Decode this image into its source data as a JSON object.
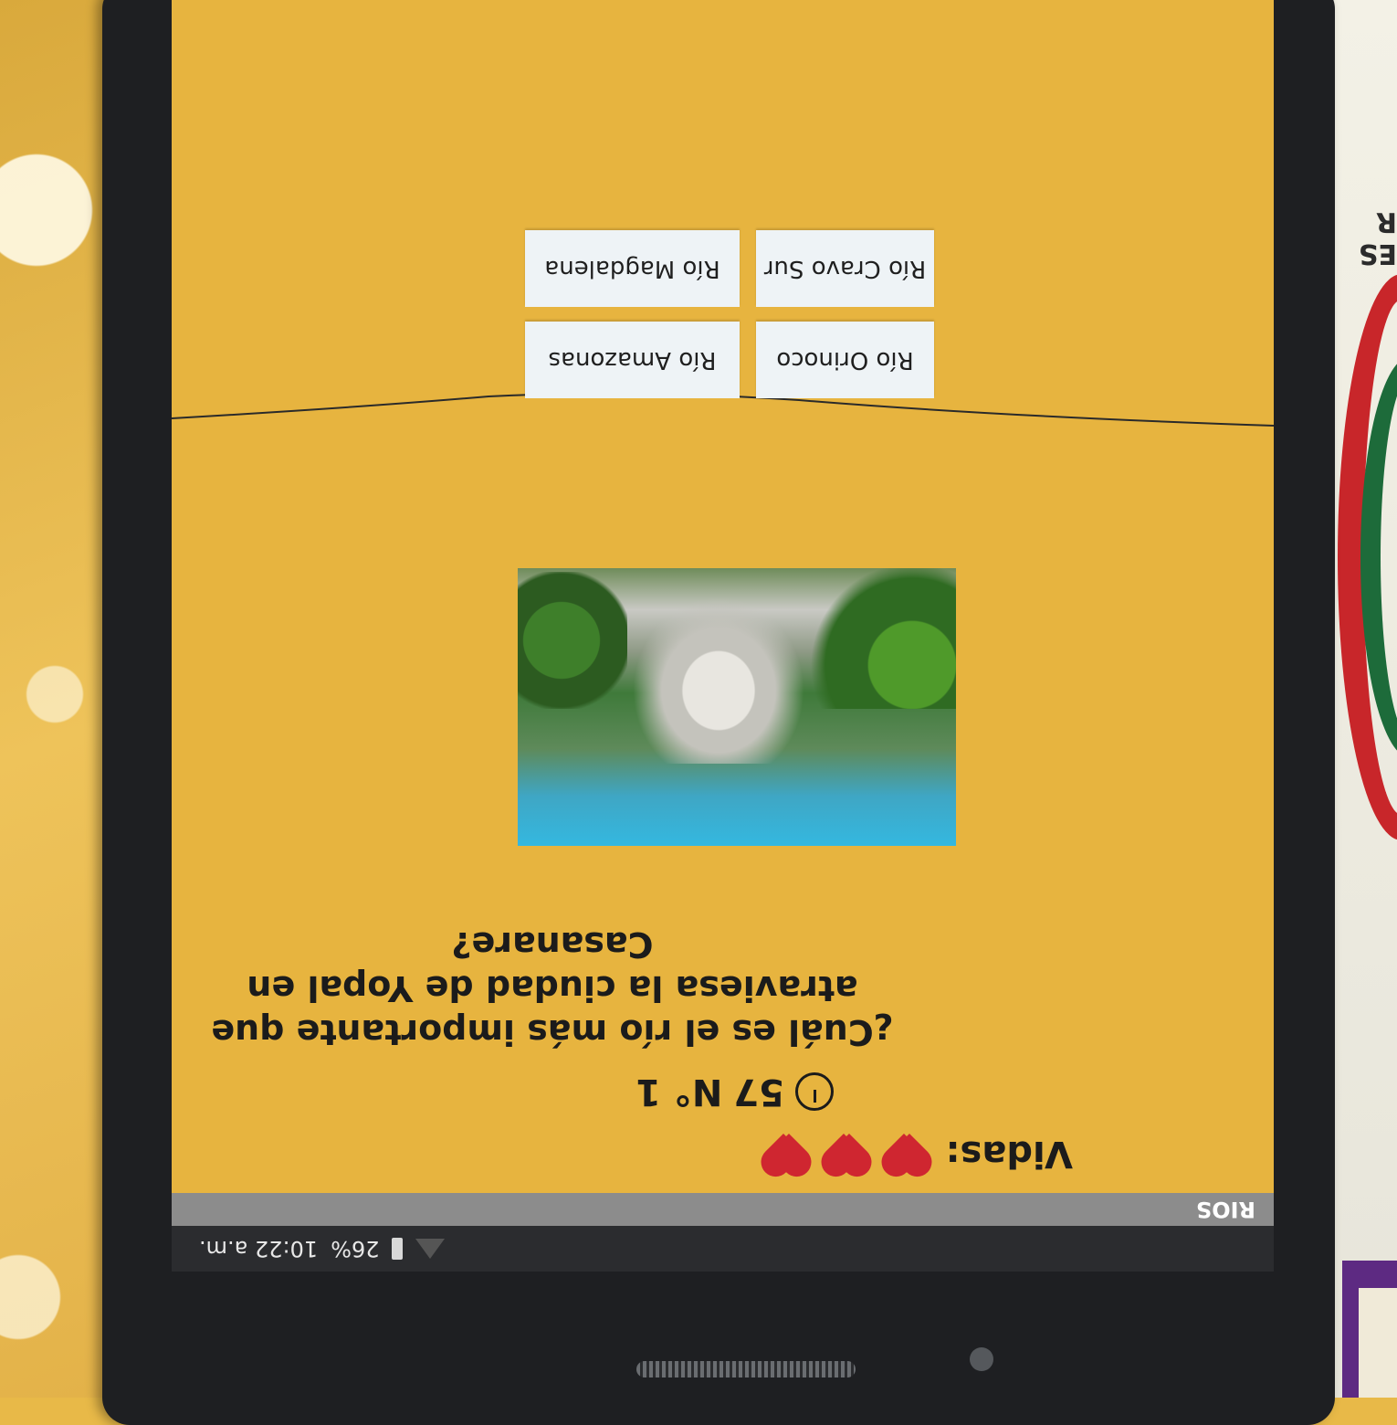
{
  "status_bar": {
    "time": "10:22 a.m.",
    "battery_percent": "26%"
  },
  "app_bar": {
    "title": "RIOS"
  },
  "game": {
    "lives_label": "Vidas:",
    "lives": 3,
    "timer_value": "57",
    "question_number": "N° 1",
    "question": "¿Cuál es el río más importante que atraviesa la ciudad de Yopal en Casanare?",
    "answers": [
      {
        "label": "Río Orinoco"
      },
      {
        "label": "Río Amazonas"
      },
      {
        "label": "Río Cravo Sur"
      },
      {
        "label": "Río Magdalena"
      }
    ]
  },
  "poster": {
    "fragment_text": "ES R"
  },
  "colors": {
    "screen_background": "#e7b43f",
    "heart": "#cf2630",
    "answer_button": "#eef3f6"
  }
}
